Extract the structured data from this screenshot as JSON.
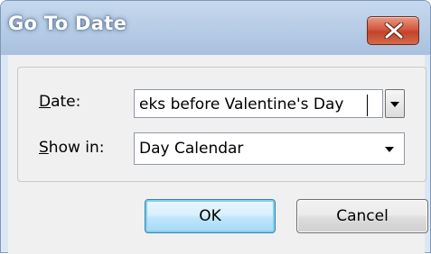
{
  "window": {
    "title": "Go To Date"
  },
  "form": {
    "date": {
      "label_prefix": "",
      "label_mnemonic": "D",
      "label_rest": "ate:",
      "value": "eks before Valentine's Day"
    },
    "show_in": {
      "label_mnemonic": "S",
      "label_rest": "how in:",
      "selected": "Day Calendar"
    }
  },
  "buttons": {
    "ok_label": "OK",
    "cancel_label": "Cancel"
  },
  "icons": {
    "close": "close-icon",
    "dropdown": "chevron-down-icon"
  },
  "colors": {
    "titlebar": "#b8cde6",
    "close_button": "#c3432a",
    "dialog_body": "#f0f0f0",
    "ok_border": "#3c7fb1"
  }
}
